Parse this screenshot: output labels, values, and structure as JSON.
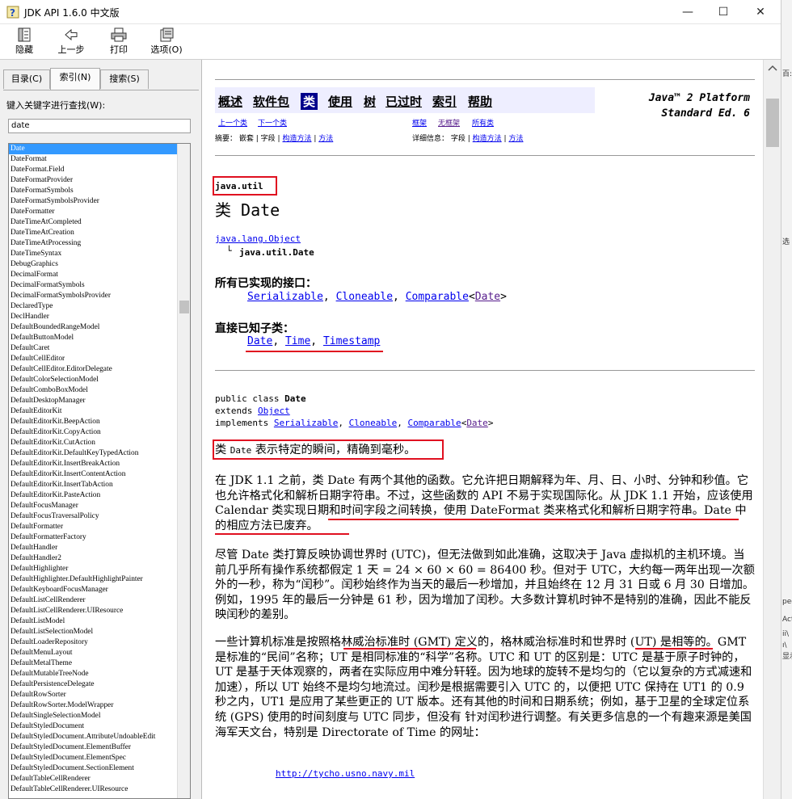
{
  "window": {
    "title": "JDK API 1.6.0 中文版",
    "controls": {
      "minimize": "—",
      "maximize": "☐",
      "close": "✕"
    }
  },
  "toolbar": {
    "hide": "隐藏",
    "back": "上一步",
    "print": "打印",
    "options": "选项(O)"
  },
  "tabs": {
    "contents": "目录(C)",
    "index": "索引(N)",
    "search": "搜索(S)"
  },
  "index_panel": {
    "label": "键入关键字进行查找(W):",
    "query": "date",
    "items": [
      "Date",
      "DateFormat",
      "DateFormat.Field",
      "DateFormatProvider",
      "DateFormatSymbols",
      "DateFormatSymbolsProvider",
      "DateFormatter",
      "DateTimeAtCompleted",
      "DateTimeAtCreation",
      "DateTimeAtProcessing",
      "DateTimeSyntax",
      "DebugGraphics",
      "DecimalFormat",
      "DecimalFormatSymbols",
      "DecimalFormatSymbolsProvider",
      "DeclaredType",
      "DeclHandler",
      "DefaultBoundedRangeModel",
      "DefaultButtonModel",
      "DefaultCaret",
      "DefaultCellEditor",
      "DefaultCellEditor.EditorDelegate",
      "DefaultColorSelectionModel",
      "DefaultComboBoxModel",
      "DefaultDesktopManager",
      "DefaultEditorKit",
      "DefaultEditorKit.BeepAction",
      "DefaultEditorKit.CopyAction",
      "DefaultEditorKit.CutAction",
      "DefaultEditorKit.DefaultKeyTypedAction",
      "DefaultEditorKit.InsertBreakAction",
      "DefaultEditorKit.InsertContentAction",
      "DefaultEditorKit.InsertTabAction",
      "DefaultEditorKit.PasteAction",
      "DefaultFocusManager",
      "DefaultFocusTraversalPolicy",
      "DefaultFormatter",
      "DefaultFormatterFactory",
      "DefaultHandler",
      "DefaultHandler2",
      "DefaultHighlighter",
      "DefaultHighlighter.DefaultHighlightPainter",
      "DefaultKeyboardFocusManager",
      "DefaultListCellRenderer",
      "DefaultListCellRenderer.UIResource",
      "DefaultListModel",
      "DefaultListSelectionModel",
      "DefaultLoaderRepository",
      "DefaultMenuLayout",
      "DefaultMetalTheme",
      "DefaultMutableTreeNode",
      "DefaultPersistenceDelegate",
      "DefaultRowSorter",
      "DefaultRowSorter.ModelWrapper",
      "DefaultSingleSelectionModel",
      "DefaultStyledDocument",
      "DefaultStyledDocument.AttributeUndoableEdit",
      "DefaultStyledDocument.ElementBuffer",
      "DefaultStyledDocument.ElementSpec",
      "DefaultStyledDocument.SectionElement",
      "DefaultTableCellRenderer",
      "DefaultTableCellRenderer.UIResource"
    ]
  },
  "doc": {
    "nav": {
      "overview": "概述",
      "package": "软件包",
      "class": "类",
      "use": "使用",
      "tree": "树",
      "deprecated": "已过时",
      "index": "索引",
      "help": "帮助"
    },
    "platform": [
      "Java™ 2 Platform",
      "Standard Ed. 6"
    ],
    "subnav": {
      "prev_class": "上一个类",
      "next_class": "下一个类",
      "frames": "框架",
      "no_frames": "无框架",
      "all_classes": "所有类",
      "summary_label": "摘要：",
      "summary_items": [
        "嵌套",
        "字段",
        "构造方法",
        "方法"
      ],
      "detail_label": "详细信息：",
      "detail_items": [
        "字段",
        "构造方法",
        "方法"
      ]
    },
    "package_name": "java.util",
    "class_title": "类 Date",
    "hierarchy": {
      "parent": "java.lang.Object",
      "child": "java.util.Date"
    },
    "interfaces_heading": "所有已实现的接口：",
    "interfaces": [
      "Serializable",
      "Cloneable",
      "Comparable"
    ],
    "interfaces_generic": "Date",
    "subclasses_heading": "直接已知子类：",
    "subclasses": [
      "Date",
      "Time",
      "Timestamp"
    ],
    "declaration": {
      "line1_pre": "public class ",
      "line1_name": "Date",
      "line2_pre": "extends ",
      "line2_link": "Object",
      "line3_pre": "implements ",
      "impl_generic": "Date"
    },
    "summary_sentence": {
      "pre": "类 ",
      "code": "Date",
      "post": " 表示特定的瞬间，精确到毫秒。"
    },
    "para1": "在 JDK 1.1 之前，类 Date 有两个其他的函数。它允许把日期解释为年、月、日、小时、分钟和秒值。它也允许格式化和解析日期字符串。不过，这些函数的 API 不易于实现国际化。从 JDK 1.1 开始，应该使用 Calendar 类实现日期和时间字段之间转换，使用 DateFormat 类来格式化和解析日期字符串。Date 中的相应方法已废弃。",
    "para2": "尽管 Date 类打算反映协调世界时 (UTC)，但无法做到如此准确，这取决于 Java 虚拟机的主机环境。当前几乎所有操作系统都假定 1 天 = 24 × 60 × 60 = 86400 秒。但对于 UTC，大约每一两年出现一次额外的一秒，称为“闰秒”。闰秒始终作为当天的最后一秒增加，并且始终在 12 月 31 日或 6 月 30 日增加。例如，1995 年的最后一分钟是 61 秒，因为增加了闰秒。大多数计算机时钟不是特别的准确，因此不能反映闰秒的差别。",
    "para3": "一些计算机标准是按照格林威治标准时 (GMT) 定义的，格林威治标准时和世界时 (UT) 是相等的。GMT 是标准的“民间”名称；UT 是相同标准的“科学”名称。UTC 和 UT 的区别是：UTC 是基于原子时钟的，UT 是基于天体观察的，两者在实际应用中难分轩轾。因为地球的旋转不是均匀的（它以复杂的方式减速和加速），所以 UT 始终不是均匀地流过。闰秒是根据需要引入 UTC 的，以便把 UTC 保持在 UT1 的 0.9 秒之内，UT1 是应用了某些更正的 UT 版本。还有其他的时间和日期系统；例如，基于卫星的全球定位系统 (GPS) 使用的时间刻度与 UTC 同步，但没有 针对闰秒进行调整。有关更多信息的一个有趣来源是美国海军天文台，特别是 Directorate of Time 的网址：",
    "url": "http://tycho.usno.navy.mil"
  },
  "side_strip": [
    "百:",
    "选",
    "ped",
    "Acti",
    "ii\\",
    "ı\\",
    "显示"
  ]
}
